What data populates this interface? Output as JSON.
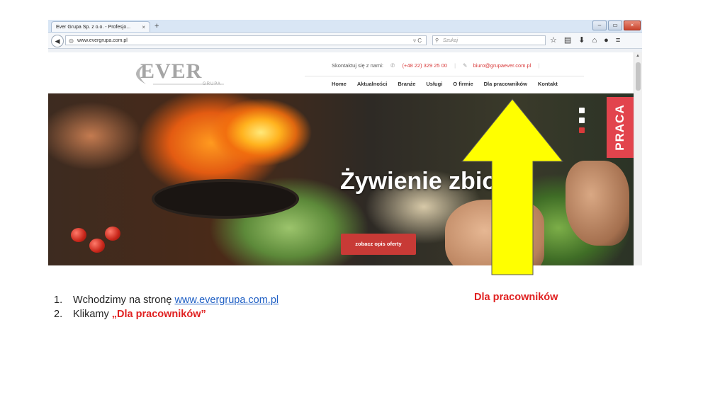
{
  "browser": {
    "tab_title": "Ever Grupa Sp. z o.o. - Profesjo...",
    "tab_close": "×",
    "new_tab": "+",
    "url": "www.evergrupa.com.pl",
    "search_placeholder": "Szukaj",
    "window_buttons": [
      "–",
      "▭",
      "×"
    ]
  },
  "site": {
    "logo_text": "EVER",
    "logo_sub": "GRUPA",
    "contact_label": "Skontaktuj się z nami:",
    "phone": "(+48 22) 329 25 00",
    "email": "biuro@grupaever.com.pl",
    "menu": [
      "Home",
      "Aktualności",
      "Branże",
      "Usługi",
      "O firmie",
      "Dla pracowników",
      "Kontakt"
    ],
    "hero_title": "Żywienie zbio",
    "cta_label": "zobacz opis oferty",
    "side_tab": "PRACA",
    "colors": {
      "brand_red": "#d83a3a",
      "praca_red": "#e2444d",
      "logo_grey": "#a5a5a5"
    }
  },
  "annotation": {
    "arrow_color": "#ffff00",
    "caption": "Dla pracowników",
    "steps": [
      {
        "num": "1.",
        "text": "Wchodzimy na stronę ",
        "link": "www.evergrupa.com.pl"
      },
      {
        "num": "2.",
        "text": "Klikamy ",
        "highlight": "„Dla pracowników”"
      }
    ]
  }
}
